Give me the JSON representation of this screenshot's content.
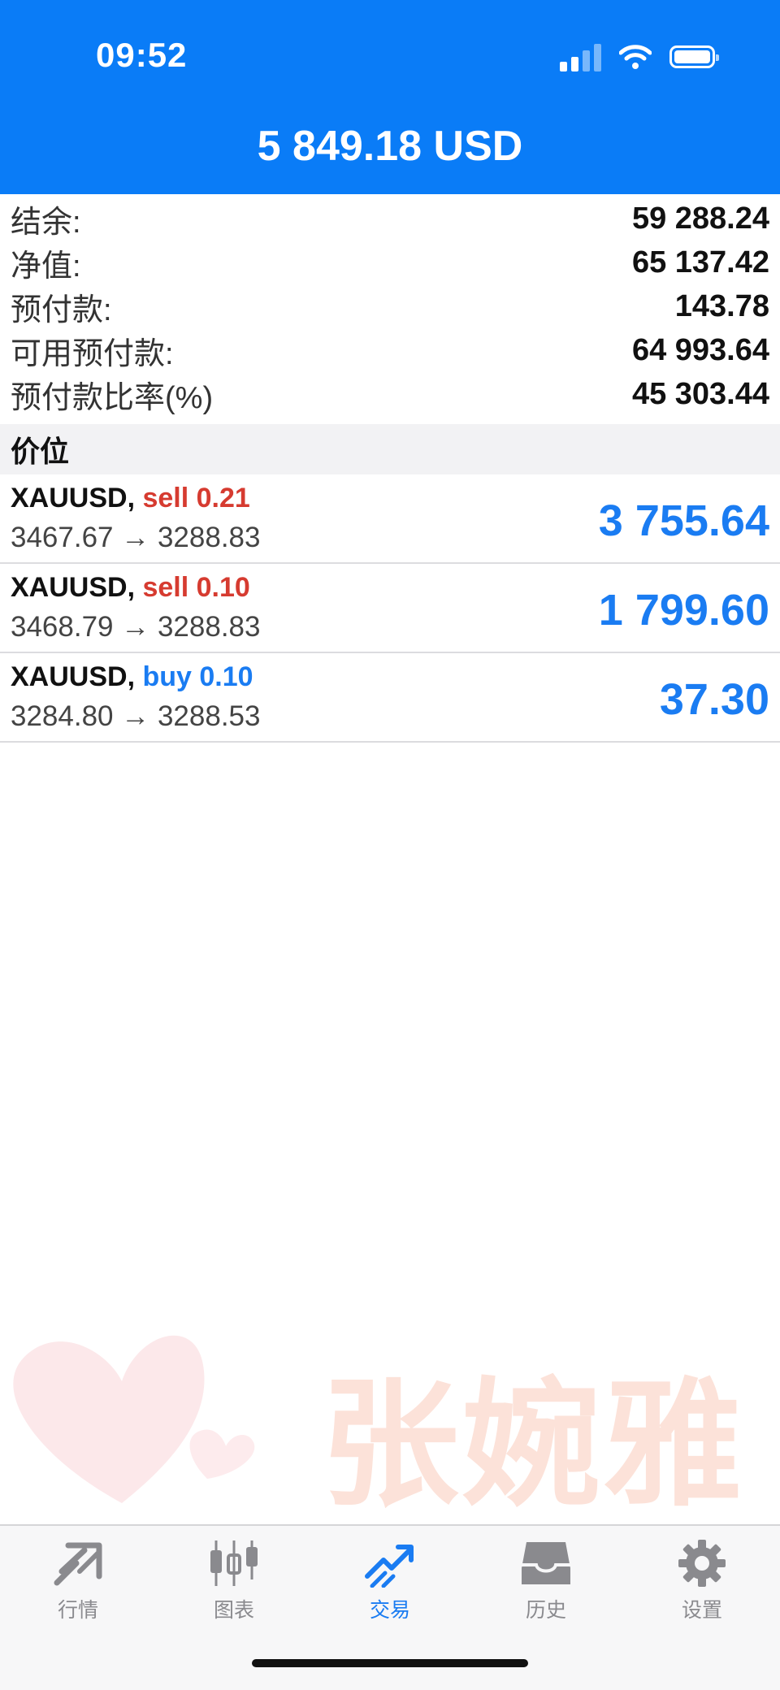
{
  "status_bar": {
    "time": "09:52"
  },
  "header": {
    "title": "5 849.18 USD"
  },
  "summary": [
    {
      "label": "结余:",
      "value": "59 288.24"
    },
    {
      "label": "净值:",
      "value": "65 137.42"
    },
    {
      "label": "预付款:",
      "value": "143.78"
    },
    {
      "label": "可用预付款:",
      "value": "64 993.64"
    },
    {
      "label": "预付款比率(%)",
      "value": "45 303.44"
    }
  ],
  "positions_header": "价位",
  "positions": [
    {
      "symbol": "XAUUSD,",
      "side": "sell 0.21",
      "prices": "3467.67 → 3288.83",
      "profit": "3 755.64"
    },
    {
      "symbol": "XAUUSD,",
      "side": "sell 0.10",
      "prices": "3468.79 → 3288.83",
      "profit": "1 799.60"
    },
    {
      "symbol": "XAUUSD,",
      "side": "buy 0.10",
      "prices": "3284.80 → 3288.53",
      "profit": "37.30"
    }
  ],
  "watermark": {
    "text": "张婉雅"
  },
  "tabs": [
    {
      "label": "行情",
      "icon": "quotes-icon"
    },
    {
      "label": "图表",
      "icon": "chart-candles-icon"
    },
    {
      "label": "交易",
      "icon": "trade-icon"
    },
    {
      "label": "历史",
      "icon": "history-inbox-icon"
    },
    {
      "label": "设置",
      "icon": "settings-gear-icon"
    }
  ],
  "colors": {
    "header": "#0a7cf7",
    "accent": "#1a7cf2",
    "sell": "#d63b30"
  }
}
